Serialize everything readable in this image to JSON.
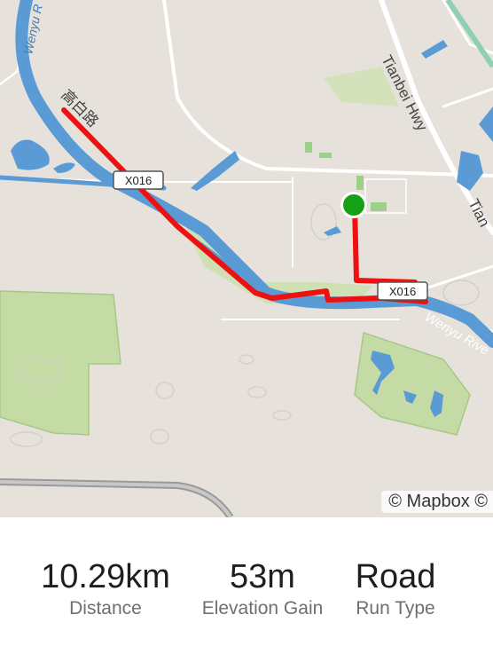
{
  "map": {
    "labels": {
      "river_top": "Wenyu R",
      "road_cn": "高白路",
      "badge_1": "X016",
      "badge_2": "X016",
      "highway": "Tianbei Hwy",
      "highway_2": "Tian",
      "river_bottom": "Wenyu Rive"
    },
    "attribution": "© Mapbox ©",
    "route_color": "#ee1111",
    "start_marker_color": "#16a016",
    "water_color": "#5b9bd5",
    "park_color": "#c5dba6"
  },
  "stats": [
    {
      "value": "10.29km",
      "label": "Distance"
    },
    {
      "value": "53m",
      "label": "Elevation Gain"
    },
    {
      "value": "Road",
      "label": "Run Type"
    }
  ]
}
